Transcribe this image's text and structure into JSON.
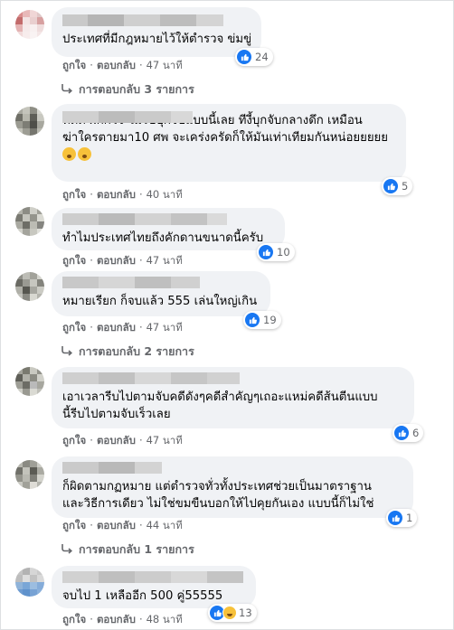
{
  "comments": [
    {
      "text": [
        "ประเทศที่มีกฎหมายไว้ให้ตำรวจ ข่มขู่"
      ],
      "reactions": "24",
      "like_label": "ถูกใจ",
      "reply_label": "ตอบกลับ",
      "time": "47 นาที",
      "replies_link": "การตอบกลับ 3 รายการ"
    },
    {
      "text": [
        "ที่ดดี้ ผกกโจ้ ไม่รีบบุกจับแบบนี้เลย ทีงี้บุกจับกลางดึก เหมือน",
        "ฆ่าใครตายมา10 ศพ จะเคร่งครัดก็ให้มันเท่าเทียมกันหน่อยยยยย"
      ],
      "reactions": "5",
      "like_label": "ถูกใจ",
      "reply_label": "ตอบกลับ",
      "time": "40 นาที"
    },
    {
      "text": [
        "ทำไมประเทศไทยถึงคักดานขนาดนี้ครับ"
      ],
      "reactions": "10",
      "like_label": "ถูกใจ",
      "reply_label": "ตอบกลับ",
      "time": "47 นาที"
    },
    {
      "text": [
        "หมายเรียก ก็จบแล้ว 555 เล่นใหญ่เกิน"
      ],
      "reactions": "19",
      "like_label": "ถูกใจ",
      "reply_label": "ตอบกลับ",
      "time": "47 นาที",
      "replies_link": "การตอบกลับ 2 รายการ"
    },
    {
      "text": [
        "เอาเวลารีบไปตามจับคดีดังๆคดีสำคัญๆเถอะแหม่คดีส้นตีนแบบ",
        "นี้รีบไปตามจับเร็วเลย"
      ],
      "reactions": "6",
      "like_label": "ถูกใจ",
      "reply_label": "ตอบกลับ",
      "time": "47 นาที"
    },
    {
      "text": [
        "ก็ผิดตามกฏหมาย แต่ตำรวจทั่วทั้งประเทศช่วยเป็นมาตราฐาน",
        "และวิธีการเดียว ไม่ใช่ขมขืนบอกให้ไปคุยกันเอง แบบนี้ก็ไม่ใช่"
      ],
      "reactions": "1",
      "like_label": "ถูกใจ",
      "reply_label": "ตอบกลับ",
      "time": "44 นาที",
      "replies_link": "การตอบกลับ 1 รายการ"
    },
    {
      "text": [
        "จบไป 1 เหลืออีก 500 คู่55555"
      ],
      "reactions": "13",
      "like_label": "ถูกใจ",
      "reply_label": "ตอบกลับ",
      "time": "48 นาที"
    }
  ],
  "colors": {
    "bubble": "#f0f2f5",
    "like_blue": "#1877f2",
    "meta_gray": "#65676b"
  },
  "icons": {
    "like": "thumbs-up-icon",
    "haha": "laughing-face-icon",
    "reply_arrow": "reply-arrow-icon"
  }
}
